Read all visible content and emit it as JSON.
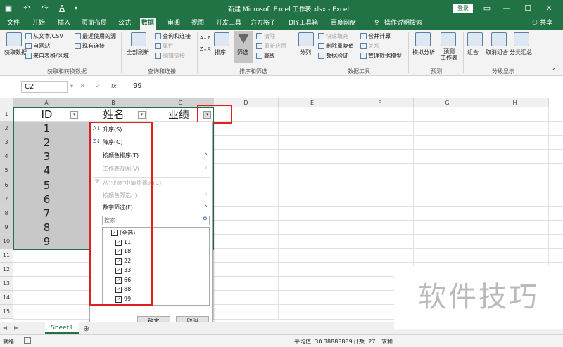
{
  "window": {
    "title": "新建 Microsoft Excel 工作表.xlsx  -  Excel",
    "login": "登录"
  },
  "tabs": [
    "文件",
    "开始",
    "插入",
    "页面布局",
    "公式",
    "数据",
    "审阅",
    "视图",
    "开发工具",
    "方方格子",
    "DIY工具箱",
    "百度网盘"
  ],
  "active_tab": "数据",
  "tell_me": "操作说明搜索",
  "share": "共享",
  "ribbon": {
    "get_data": "获取数据",
    "from_text": "从文本/CSV",
    "from_web": "自网站",
    "from_table": "来自表格/区域",
    "recent_sources": "最近使用的源",
    "existing_conn": "现有连接",
    "group1": "获取和转换数据",
    "refresh_all": "全部刷新",
    "queries_conn": "查询和连接",
    "properties": "属性",
    "edit_links": "编辑链接",
    "group2": "查询和连接",
    "sort": "排序",
    "filter": "筛选",
    "clear": "清除",
    "reapply": "重新应用",
    "advanced": "高级",
    "group3": "排序和筛选",
    "split": "分列",
    "flash_fill": "快速填充",
    "remove_dup": "删除重复值",
    "validation": "数据验证",
    "consolidate": "合并计算",
    "relations": "关系",
    "manage_model": "管理数据模型",
    "group4": "数据工具",
    "whatif": "模拟分析",
    "forecast": "预测\n工作表",
    "group5": "预测",
    "group_btn": "组合",
    "ungroup": "取消组合",
    "subtotal": "分类汇总",
    "group6": "分级显示"
  },
  "formula_bar": {
    "name_box": "C2",
    "value": "99"
  },
  "columns": [
    "A",
    "B",
    "C",
    "D",
    "E",
    "F",
    "G",
    "H"
  ],
  "rows": [
    "1",
    "2",
    "3",
    "4",
    "5",
    "6",
    "7",
    "8",
    "9",
    "10",
    "11",
    "12",
    "13",
    "14",
    "15"
  ],
  "headers": {
    "a": "ID",
    "b": "姓名",
    "c": "业绩"
  },
  "ids": [
    "1",
    "2",
    "3",
    "4",
    "5",
    "6",
    "7",
    "8",
    "9"
  ],
  "menu": {
    "sort_asc": "升序(S)",
    "sort_desc": "降序(O)",
    "sort_color": "按颜色排序(T)",
    "sheet_view": "工作表视图(V)",
    "clear_filter": "从\"业绩\"中清除筛选(C)",
    "filter_color": "按颜色筛选(I)",
    "number_filter": "数字筛选(F)",
    "search_placeholder": "搜索",
    "items": [
      "(全选)",
      "11",
      "18",
      "22",
      "33",
      "66",
      "88",
      "99"
    ],
    "ok": "确定",
    "cancel": "取消"
  },
  "sheet": "Sheet1",
  "status": {
    "ready": "就绪",
    "average": "平均值: 30.38888889",
    "count": "计数: 27",
    "sum": "求和"
  },
  "watermark": "软件技巧",
  "colors": {
    "brand": "#217346",
    "selection": "#c8c8c8",
    "highlight": "#e02020"
  }
}
